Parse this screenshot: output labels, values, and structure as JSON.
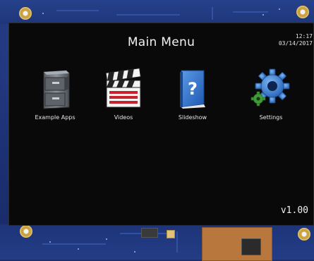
{
  "screen": {
    "title": "Main Menu",
    "time": "12:17",
    "date": "03/14/2017",
    "version": "v1.00"
  },
  "menu": {
    "items": [
      {
        "label": "Example Apps",
        "icon": "file-cabinet-icon"
      },
      {
        "label": "Videos",
        "icon": "clapperboard-icon"
      },
      {
        "label": "Slideshow",
        "icon": "help-book-icon"
      },
      {
        "label": "Settings",
        "icon": "gear-icon"
      }
    ]
  },
  "colors": {
    "screen_bg": "#090909",
    "pcb": "#1d3176",
    "text": "#f2f2f2",
    "gear_blue": "#3b83d6",
    "book_blue": "#2f74d0"
  }
}
